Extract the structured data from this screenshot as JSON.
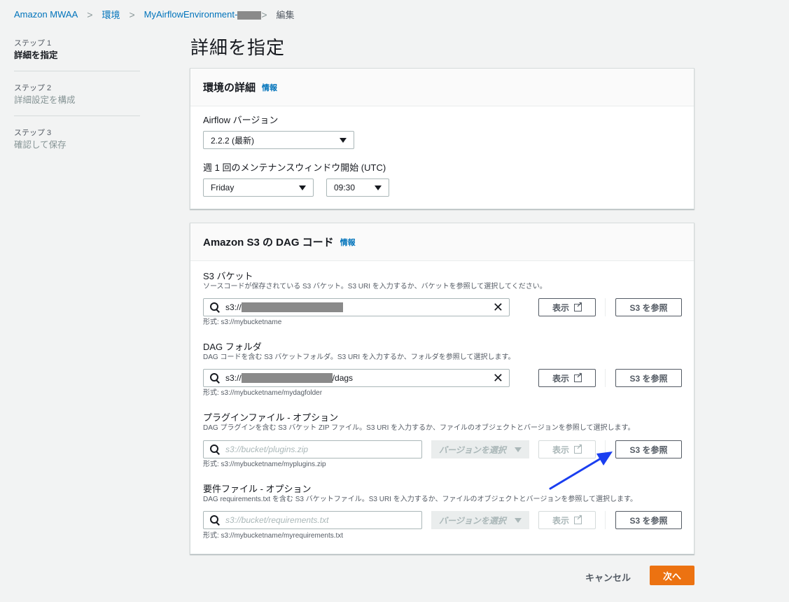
{
  "breadcrumb": {
    "items": [
      "Amazon MWAA",
      "環境",
      "MyAirflowEnvironment-"
    ],
    "current": "編集"
  },
  "steps": [
    {
      "num": "ステップ 1",
      "title": "詳細を指定"
    },
    {
      "num": "ステップ 2",
      "title": "詳細設定を構成"
    },
    {
      "num": "ステップ 3",
      "title": "確認して保存"
    }
  ],
  "page_title": "詳細を指定",
  "env_details": {
    "title": "環境の詳細",
    "info": "情報",
    "airflow_version_label": "Airflow バージョン",
    "airflow_version_value": "2.2.2 (最新)",
    "maintenance_label": "週 1 回のメンテナンスウィンドウ開始 (UTC)",
    "maintenance_day": "Friday",
    "maintenance_time": "09:30"
  },
  "dag_code": {
    "title": "Amazon S3 の DAG コード",
    "info": "情報",
    "s3_bucket": {
      "label": "S3 バケット",
      "desc": "ソースコードが保存されている S3 バケット。S3 URI を入力するか、バケットを参照して選択してください。",
      "value_prefix": "s3://",
      "value_suffix": "",
      "hint": "形式: s3://mybucketname",
      "view_label": "表示",
      "browse_label": "S3 を参照"
    },
    "dag_folder": {
      "label": "DAG フォルダ",
      "desc": "DAG コードを含む S3 バケットフォルダ。S3 URI を入力するか、フォルダを参照して選択します。",
      "value_prefix": "s3://",
      "value_suffix": "/dags",
      "hint": "形式: s3://mybucketname/mydagfolder",
      "view_label": "表示",
      "browse_label": "S3 を参照"
    },
    "plugins": {
      "label": "プラグインファイル - オプション",
      "desc": "DAG プラグインを含む S3 バケット ZIP ファイル。S3 URI を入力するか、ファイルのオブジェクトとバージョンを参照して選択します。",
      "placeholder": "s3://bucket/plugins.zip",
      "version_label": "バージョンを選択",
      "hint": "形式: s3://mybucketname/myplugins.zip",
      "view_label": "表示",
      "browse_label": "S3 を参照"
    },
    "requirements": {
      "label": "要件ファイル - オプション",
      "desc": "DAG requirements.txt を含む S3 バケットファイル。S3 URI を入力するか、ファイルのオブジェクトとバージョンを参照して選択します。",
      "placeholder": "s3://bucket/requirements.txt",
      "version_label": "バージョンを選択",
      "hint": "形式: s3://mybucketname/myrequirements.txt",
      "view_label": "表示",
      "browse_label": "S3 を参照"
    }
  },
  "footer": {
    "cancel_label": "キャンセル",
    "next_label": "次へ"
  },
  "colors": {
    "link": "#0073bb",
    "primary_button": "#ec7211",
    "annotation_arrow": "#1a3ef0"
  }
}
